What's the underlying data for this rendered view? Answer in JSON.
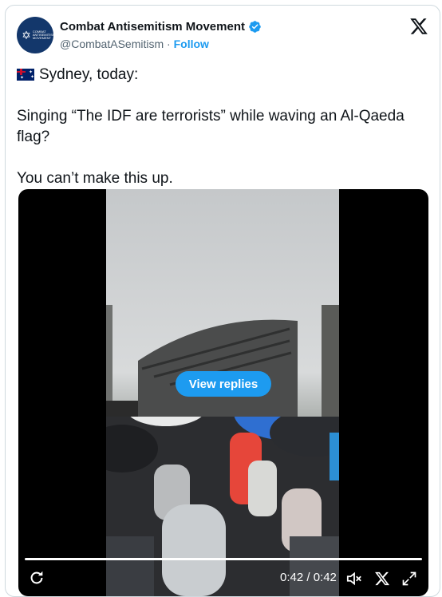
{
  "author": {
    "name": "Combat Antisemitism Movement",
    "handle": "@CombatASemitism",
    "separator": "·",
    "follow_label": "Follow",
    "avatar_text": "COMBAT ANTISEMITISM MOVEMENT"
  },
  "tweet": {
    "line1": "Sydney, today:",
    "line2": "Singing “The IDF are terrorists” while waving an Al-Qaeda flag?",
    "line3": "You can’t make this up."
  },
  "video": {
    "replies_label": "View replies",
    "time": "0:42 / 0:42",
    "progress": 1.0
  },
  "colors": {
    "accent": "#1d9bf0",
    "avatar_bg": "#13376b",
    "border": "#cfd9de",
    "muted_text": "#536471"
  },
  "icons": {
    "verified": "verified-badge-icon",
    "brand": "x-logo-icon",
    "replay": "replay-icon",
    "mute": "mute-icon",
    "expand": "expand-icon"
  }
}
